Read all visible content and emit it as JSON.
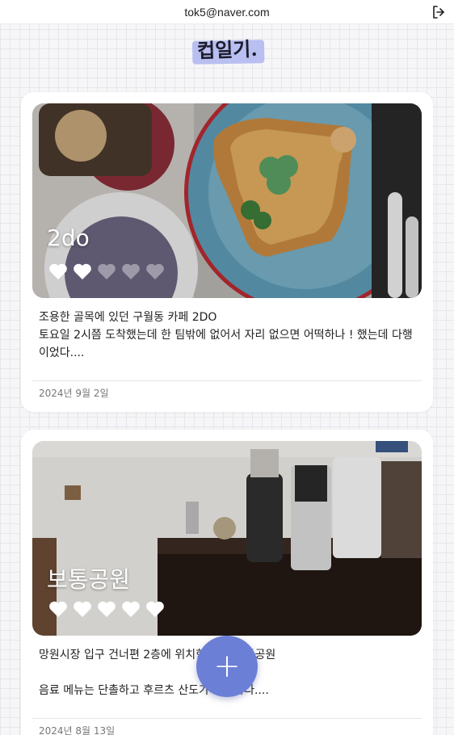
{
  "header": {
    "email": "tok5@naver.com",
    "logout_icon": "logout-icon"
  },
  "brand": {
    "logo_text": "컵일기."
  },
  "entries": [
    {
      "title": "2do",
      "rating": 2,
      "rating_max": 5,
      "description": "조용한 골목에 있던 구월동 카페 2DO\n토요일 2시쯤 도착했는데 한 팀밖에 없어서 자리 없으면 어떡하나 ! 했는데 다행이었다....",
      "date": "2024년 9월 2일"
    },
    {
      "title": "보통공원",
      "rating": 5,
      "rating_max": 5,
      "description": "망원시장 입구 건너편 2층에 위치한 카페 보통공원\n\n음료 메뉴는 단촐하고 후르츠 산도가 유명하다....",
      "date": "2024년 8월 13일"
    }
  ],
  "fab": {
    "label": "+",
    "icon": "plus-icon"
  },
  "colors": {
    "accent": "#6b7fd6",
    "highlight": "#b9bff0"
  }
}
